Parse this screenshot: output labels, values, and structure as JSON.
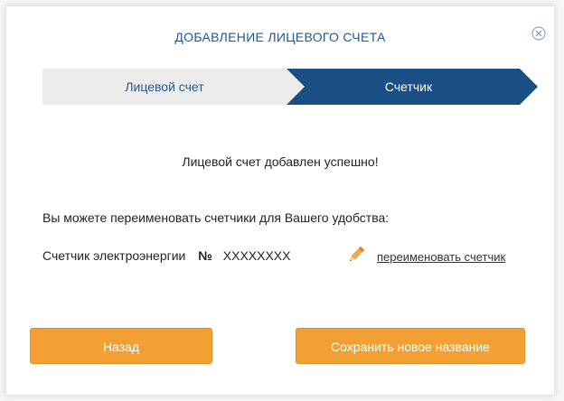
{
  "dialog": {
    "title": "ДОБАВЛЕНИЕ ЛИЦЕВОГО СЧЕТА",
    "close_icon": "close-circle-icon"
  },
  "steps": [
    {
      "label": "Лицевой счет",
      "state": "inactive"
    },
    {
      "label": "Счетчик",
      "state": "active"
    }
  ],
  "message": {
    "success": "Лицевой счет добавлен успешно!",
    "hint": "Вы можете переименовать счетчики для Вашего удобства:"
  },
  "meter": {
    "label": "Счетчик электроэнергии",
    "number_sign": "№",
    "number": "XXXXXXXX",
    "edit_icon": "pencil-icon",
    "rename_link": "переименовать счетчик"
  },
  "buttons": {
    "back": "Назад",
    "save": "Сохранить новое название"
  },
  "colors": {
    "accent": "#1d5a92",
    "button": "#f2a033",
    "inactive_step": "#ececec",
    "active_step": "#1a4f86"
  }
}
